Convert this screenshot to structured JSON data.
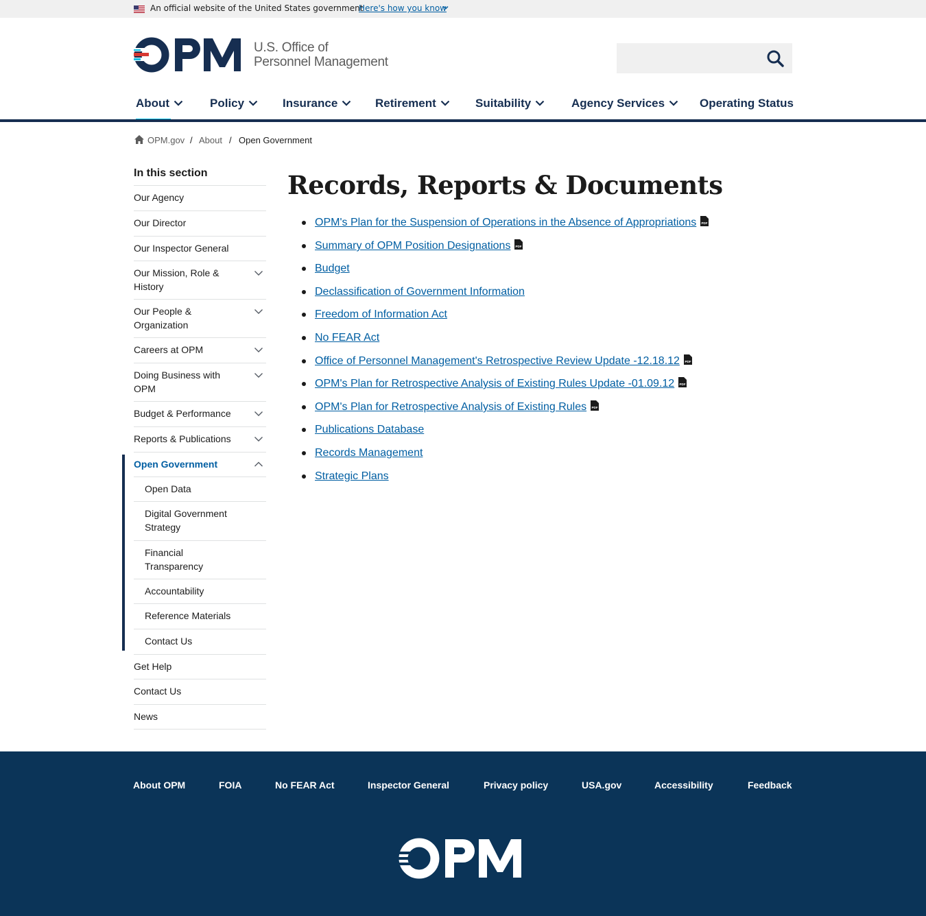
{
  "gov_banner": {
    "text": "An official website of the United States government",
    "link": "Here's how you know"
  },
  "header": {
    "logo_text": "OPM",
    "logo_line1": "U.S. Office of",
    "logo_line2": "Personnel Management",
    "search_placeholder": ""
  },
  "nav": {
    "items": [
      {
        "label": "About"
      },
      {
        "label": "Policy"
      },
      {
        "label": "Insurance"
      },
      {
        "label": "Retirement"
      },
      {
        "label": "Suitability"
      },
      {
        "label": "Agency Services"
      },
      {
        "label": "Operating Status"
      }
    ]
  },
  "breadcrumb": {
    "home": "OPM.gov",
    "sep": "/",
    "about": "About",
    "current": "Open Government"
  },
  "sidebar": {
    "heading": "In this section",
    "items": [
      {
        "label": "Our Agency"
      },
      {
        "label": "Our Director"
      },
      {
        "label": "Our Inspector General"
      },
      {
        "label": "Our Mission, Role & History"
      },
      {
        "label": "Our People & Organization"
      },
      {
        "label": "Careers at OPM"
      },
      {
        "label": "Doing Business with OPM"
      },
      {
        "label": "Budget & Performance"
      },
      {
        "label": "Reports & Publications"
      },
      {
        "label": "Open Government"
      },
      {
        "label": "Open Data"
      },
      {
        "label": "Digital Government Strategy"
      },
      {
        "label": "Financial Transparency"
      },
      {
        "label": "Accountability"
      },
      {
        "label": "Reference Materials"
      },
      {
        "label": "Contact Us"
      },
      {
        "label": "Get Help"
      },
      {
        "label": "Contact Us"
      },
      {
        "label": "News"
      }
    ]
  },
  "main": {
    "title": "Records, Reports & Documents",
    "links": [
      {
        "label": "OPM's Plan for the Suspension of Operations in the Absence of Appropriations",
        "pdf": true
      },
      {
        "label": "Summary of OPM Position Designations",
        "pdf": true
      },
      {
        "label": "Budget",
        "pdf": false
      },
      {
        "label": "Declassification of Government Information",
        "pdf": false
      },
      {
        "label": "Freedom of Information Act",
        "pdf": false
      },
      {
        "label": "No FEAR Act",
        "pdf": false
      },
      {
        "label": "Office of Personnel Management's Retrospective Review Update -12.18.12",
        "pdf": true
      },
      {
        "label": "OPM's Plan for Retrospective Analysis of Existing Rules Update -01.09.12",
        "pdf": true
      },
      {
        "label": "OPM's Plan for Retrospective Analysis of Existing Rules",
        "pdf": true
      },
      {
        "label": "Publications Database",
        "pdf": false
      },
      {
        "label": "Records Management",
        "pdf": false
      },
      {
        "label": "Strategic Plans",
        "pdf": false
      }
    ]
  },
  "footer": {
    "links": [
      {
        "label": "About OPM"
      },
      {
        "label": "FOIA"
      },
      {
        "label": "No FEAR Act"
      },
      {
        "label": "Inspector General"
      },
      {
        "label": "Privacy policy"
      },
      {
        "label": "USA.gov"
      },
      {
        "label": "Accessibility"
      },
      {
        "label": "Feedback"
      }
    ],
    "logo_text": "OPM"
  },
  "colors": {
    "navy": "#162e51",
    "link": "#005ea2",
    "accent": "#00bde3",
    "footer_bg": "#0b3458",
    "logo_red": "#d83933"
  }
}
